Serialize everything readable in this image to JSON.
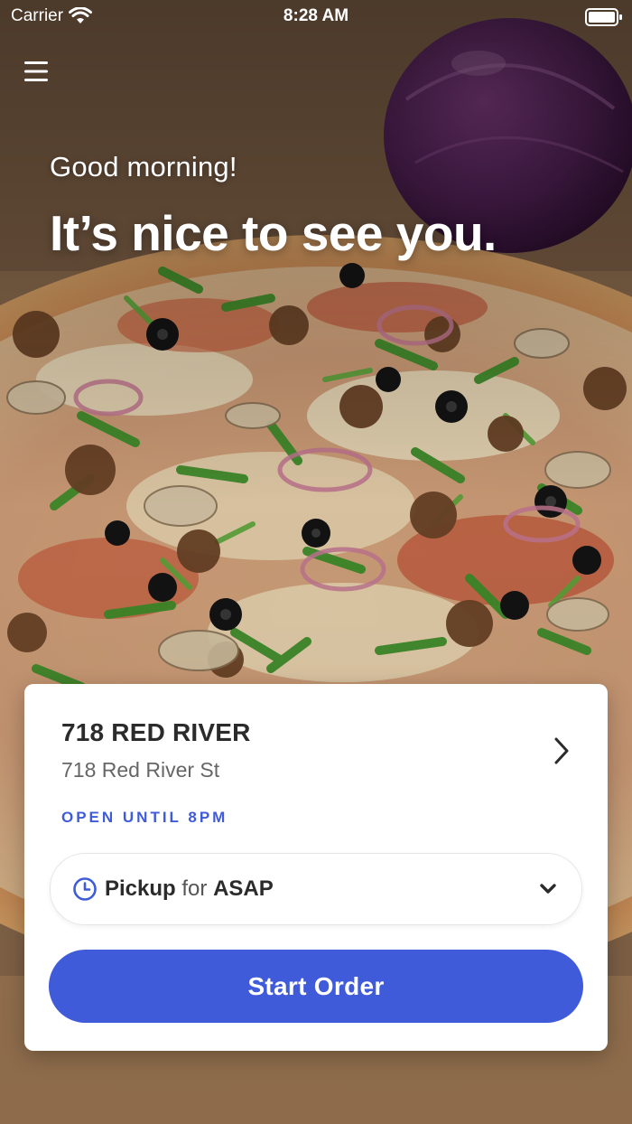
{
  "status_bar": {
    "carrier": "Carrier",
    "time": "8:28 AM",
    "icons": [
      "wifi-icon",
      "battery-icon"
    ]
  },
  "menu": {
    "icon": "hamburger-menu-icon"
  },
  "greeting": {
    "salutation": "Good morning!",
    "headline": "It’s nice to see you."
  },
  "store": {
    "name": "718 RED RIVER",
    "address": "718 Red River St",
    "hours": "OPEN UNTIL 8PM",
    "chevron_icon": "chevron-right-icon"
  },
  "order_type": {
    "mode": "Pickup",
    "connector": "for",
    "time": "ASAP",
    "clock_icon": "clock-icon",
    "dropdown_icon": "chevron-down-icon"
  },
  "cta": {
    "label": "Start Order"
  },
  "colors": {
    "accent": "#3f5bd9",
    "card_background": "#ffffff",
    "text_primary": "#2b2b2b",
    "text_secondary": "#666666"
  }
}
